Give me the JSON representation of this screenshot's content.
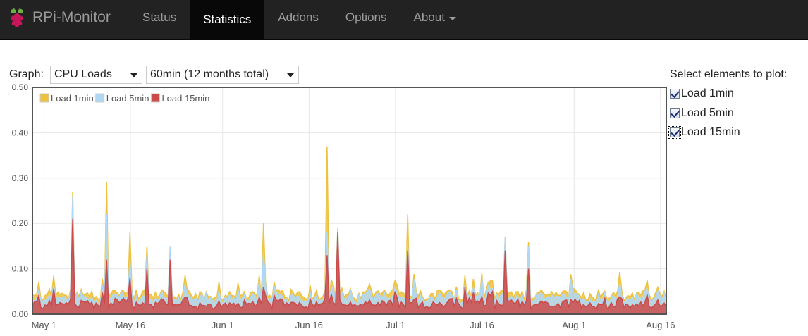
{
  "navbar": {
    "brand": "RPi-Monitor",
    "items": [
      {
        "label": "Status",
        "active": false
      },
      {
        "label": "Statistics",
        "active": true
      },
      {
        "label": "Addons",
        "active": false
      },
      {
        "label": "Options",
        "active": false
      },
      {
        "label": "About",
        "active": false,
        "dropdown": true
      }
    ]
  },
  "controls": {
    "graph_label": "Graph:",
    "graph_selected": "CPU Loads",
    "period_selected": "60min (12 months total)"
  },
  "plot_select": {
    "title": "Select elements to plot:",
    "options": [
      {
        "label": "Load 1min",
        "checked": true
      },
      {
        "label": "Load 5min",
        "checked": true
      },
      {
        "label": "Load 15min",
        "checked": true
      }
    ]
  },
  "chart_data": {
    "type": "area",
    "title": "",
    "xlabel": "",
    "ylabel": "",
    "ylim": [
      0,
      0.5
    ],
    "y_ticks": [
      "0.00",
      "0.10",
      "0.20",
      "0.30",
      "0.40",
      "0.50"
    ],
    "x_ticks": [
      "May 1",
      "May 16",
      "Jun 1",
      "Jun 16",
      "Jul 1",
      "Jul 16",
      "Aug 1",
      "Aug 16"
    ],
    "x_start": "2013-04-29",
    "x_end": "2013-08-17",
    "grid": true,
    "legend_position": "top-left",
    "series": [
      {
        "name": "Load 1min",
        "color": "#edc240"
      },
      {
        "name": "Load 5min",
        "color": "#afd8f8"
      },
      {
        "name": "Load 15min",
        "color": "#cb4b4b"
      }
    ],
    "peaks": [
      {
        "date": "2013-05-06",
        "load1": 0.27,
        "load5": 0.26,
        "load15": 0.21
      },
      {
        "date": "2013-05-12",
        "load1": 0.29,
        "load5": 0.22,
        "load15": 0.12
      },
      {
        "date": "2013-05-16",
        "load1": 0.18,
        "load5": 0.12,
        "load15": 0.08
      },
      {
        "date": "2013-05-19",
        "load1": 0.15,
        "load5": 0.13,
        "load15": 0.1
      },
      {
        "date": "2013-05-23",
        "load1": 0.15,
        "load5": 0.15,
        "load15": 0.12
      },
      {
        "date": "2013-06-08",
        "load1": 0.2,
        "load5": 0.14,
        "load15": 0.06
      },
      {
        "date": "2013-06-19",
        "load1": 0.37,
        "load5": 0.18,
        "load15": 0.13
      },
      {
        "date": "2013-06-21",
        "load1": 0.19,
        "load5": 0.19,
        "load15": 0.18
      },
      {
        "date": "2013-07-03",
        "load1": 0.22,
        "load5": 0.16,
        "load15": 0.14
      },
      {
        "date": "2013-07-20",
        "load1": 0.17,
        "load5": 0.17,
        "load15": 0.14
      },
      {
        "date": "2013-07-24",
        "load1": 0.16,
        "load5": 0.15,
        "load15": 0.1
      }
    ]
  }
}
